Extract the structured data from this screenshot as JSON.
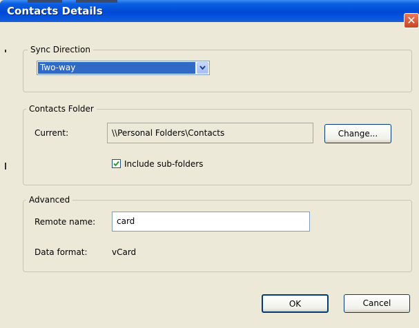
{
  "window": {
    "title": "Contacts Details",
    "close_glyph": "✕"
  },
  "sync_direction": {
    "legend": "Sync Direction",
    "selected": "Two-way"
  },
  "contacts_folder": {
    "legend": "Contacts Folder",
    "current_label": "Current:",
    "current_value": "\\\\Personal Folders\\Contacts",
    "change_button": "Change...",
    "include_subfolders_label": "Include sub-folders",
    "include_subfolders_checked": true
  },
  "advanced": {
    "legend": "Advanced",
    "remote_name_label": "Remote name:",
    "remote_name_value": "card",
    "data_format_label": "Data format:",
    "data_format_value": "vCard"
  },
  "footer": {
    "ok_button": "OK",
    "cancel_button": "Cancel"
  },
  "icons": {
    "close": "close-icon",
    "dropdown": "chevron-down-icon",
    "check": "check-icon"
  },
  "colors": {
    "title_bar": "#0a5fe0",
    "selection": "#316ac5",
    "close_button": "#c94421",
    "dialog_bg": "#ece9d8"
  }
}
